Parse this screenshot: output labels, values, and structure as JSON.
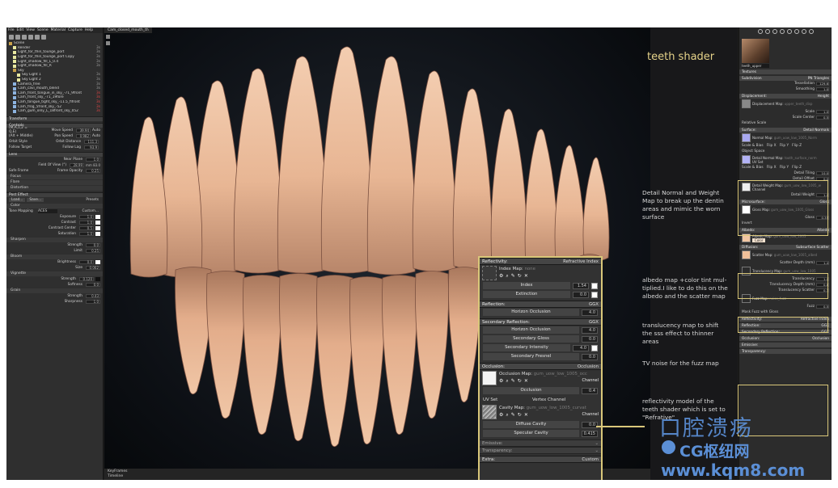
{
  "menubar": [
    "File",
    "Edit",
    "View",
    "Scene",
    "Material",
    "Capture",
    "Help"
  ],
  "viewport": {
    "tab": "Cam_closed_mouth_th",
    "footer": [
      "KeyFrames",
      "Timeline"
    ]
  },
  "scene": [
    {
      "label": "Scene",
      "icon": "scene",
      "vis": ""
    },
    {
      "label": "Render",
      "icon": "light",
      "vis": "3s"
    },
    {
      "label": "Light_for_thin_tounge_port",
      "icon": "light",
      "vis": "3s"
    },
    {
      "label": "Light_for_thin_tounge_port Copy",
      "icon": "light",
      "vis": "3s"
    },
    {
      "label": "Light_shadow_fill_L_0.4",
      "icon": "light",
      "vis": "3s"
    },
    {
      "label": "Light_shadow_fill_R",
      "icon": "light",
      "vis": "3s"
    },
    {
      "label": "Sky",
      "icon": "scene",
      "vis": ""
    },
    {
      "label": "Sky Light 1",
      "icon": "light",
      "vis": "3s"
    },
    {
      "label": "Sky Light 2",
      "icon": "light",
      "vis": "3s"
    },
    {
      "label": "Camera_free",
      "icon": "camera",
      "vis": "3s"
    },
    {
      "label": "Cam_cavi_mouth_blend",
      "icon": "camera",
      "vis": "3s"
    },
    {
      "label": "Cam_front_tongue_in_sky_-71_9front",
      "icon": "camera",
      "vis": "3s"
    },
    {
      "label": "Cam_front_sky_-71_19fore",
      "icon": "camera",
      "vis": "3s"
    },
    {
      "label": "Cam_tongue_tight_sky_-11.5_fifront",
      "icon": "camera",
      "vis": "3s"
    },
    {
      "label": "Cam_frog_5front_sky_-52",
      "icon": "camera",
      "vis": "3s"
    },
    {
      "label": "Cam_gum_only_L_18front_sky_052",
      "icon": "camera",
      "vis": "3s"
    }
  ],
  "left": {
    "transform": "Transform",
    "controls": "Controls",
    "ctrl_rows": [
      [
        "(M,A,1,2 = Q,E)",
        "Move Speed",
        "39.94",
        "Auto"
      ],
      [
        "(Alt + Middle)",
        "Pan Speed",
        "0.982",
        "Auto"
      ],
      [
        "Orbit Style",
        "Orbit Distance",
        "111.3",
        ""
      ],
      [
        "Follow Target",
        "Follow Lag",
        "93.9",
        ""
      ]
    ],
    "lens": "Lens",
    "lens_rows": [
      [
        "Near Plane",
        "1.0"
      ],
      [
        "Field Of View (°)",
        "28.99"
      ],
      [
        "Safe Frame",
        "Frame Opacity",
        "0.25"
      ]
    ],
    "lens_extra": "mm 83.0",
    "focus": "Focus",
    "flare": "Flare",
    "distortion": "Distortion",
    "post": "Post Effect",
    "post_buttons": [
      "Load...",
      "Save..."
    ],
    "presets": "Presets",
    "color": "Color",
    "tone": "Tone Mapping",
    "tone_val": "ACES",
    "custom": "Custom...",
    "color_rows": [
      [
        "Exposure",
        "1.0"
      ],
      [
        "Contrast",
        "1.0"
      ],
      [
        "Contrast Center",
        "0.5"
      ],
      [
        "Saturation",
        "1.0"
      ]
    ],
    "sharpen": "Sharpen",
    "sharpen_rows": [
      [
        "Strength",
        "0.0"
      ],
      [
        "Limit",
        "0.25"
      ]
    ],
    "bloom": "Bloom",
    "bloom_rows": [
      [
        "Brightness",
        "0.0"
      ],
      [
        "Size",
        "0.062"
      ]
    ],
    "vignette": "Vignette",
    "vign_rows": [
      [
        "Strength",
        "0.120"
      ],
      [
        "Softness",
        "0.0"
      ]
    ],
    "grain": "Grain",
    "grain_rows": [
      [
        "Strength",
        "0.43"
      ],
      [
        "Sharpness",
        "1.0"
      ]
    ]
  },
  "overlay": {
    "reflectivity": {
      "title": "Reflectivity:",
      "value": "Refractive Index",
      "map": "Index Map:",
      "map_val": "none",
      "rows": [
        [
          "Index",
          "1.54"
        ],
        [
          "Extinction",
          "0.0"
        ]
      ]
    },
    "reflection": {
      "title": "Reflection:",
      "value": "GGX",
      "rows": [
        [
          "Horizon Occlusion",
          "4.0"
        ]
      ]
    },
    "secondary": {
      "title": "Secondary Reflection:",
      "value": "GGX",
      "rows": [
        [
          "Horizon Occlusion",
          "4.0"
        ],
        [
          "Secondary Gloss",
          "0.0"
        ],
        [
          "Secondary Intensity",
          "4.0"
        ],
        [
          "Secondary Fresnel",
          "0.0"
        ]
      ]
    },
    "occlusion": {
      "title": "Occlusion:",
      "value": "Occlusion",
      "map": "Occlusion Map:",
      "map_val": "gum_uow_low_1005_occ",
      "channel": "Channel",
      "occ_label": "Occlusion",
      "occ_val": "0.4",
      "uv": "UV Set",
      "uv_val": "Vertex Channel",
      "cav_map": "Cavity Map:",
      "cav_val": "gum_uow_low_1005_curvat",
      "cav_rows": [
        [
          "Diffuse Cavity",
          "0.0"
        ],
        [
          "Specular Cavity",
          "0.415"
        ]
      ]
    },
    "emissive": "Emissive:",
    "transparency": "Transparency:",
    "extra": {
      "title": "Extra:",
      "value": "Custom"
    }
  },
  "right": {
    "mat_name": "teeth_upper",
    "sections": [
      "Textures",
      "Subdivision"
    ],
    "subdiv_val": "PN Triangles",
    "subdiv_rows": [
      [
        "Tessellation",
        "129.6"
      ],
      [
        "Smoothing",
        "1.0"
      ]
    ],
    "displacement": "Displacement:",
    "disp_val": "Height",
    "disp_map": "Displacement Map:",
    "disp_map_val": "upper_teeth_disp",
    "disp_rows": [
      [
        "Scale",
        "1.0"
      ],
      [
        "Scale Center",
        "0.5"
      ]
    ],
    "relative": "Relative Scale",
    "surface": "Surface:",
    "surface_val": "Detail Normals",
    "normal_map": "Normal Map:",
    "normal_map_val": "gum_uow_low_1005_Norm",
    "scale_bias": [
      "Scale & Bias",
      "Flip X",
      "Flip Y",
      "Flip Z"
    ],
    "object_space": "Object Space",
    "detail_normal": "Detail Normal Map:",
    "detail_normal_val": "tooth_surface_norm",
    "uv_set": "UV Set",
    "detail_rows": [
      [
        "Detail Tiling",
        "10.0"
      ],
      [
        "Detail Offset",
        "0.0"
      ]
    ],
    "detail_weight": "Detail Weight Map:",
    "detail_weight_val": "gum_uow_low_1005_w",
    "channel": "Channel",
    "detail_weight_row": [
      "Detail Weight",
      "1.0"
    ],
    "microsurface": "Microsurface:",
    "micro_val": "Gloss",
    "gloss_map": "Gloss Map:",
    "gloss_map_val": "gum_uow_low_1005_Gloss",
    "gloss_row": [
      "Gloss",
      "0.35"
    ],
    "invert": "Invert",
    "albedo": "Albedo:",
    "albedo_val": "Albedo",
    "albedo_map": "Albedo Map:",
    "albedo_map_val": "gum_uow_low_1005",
    "color": "Color",
    "diffusion": "Diffusion:",
    "diffusion_val": "Subsurface Scatter",
    "scatter_map": "Scatter Map:",
    "scatter_map_val": "gum_uow_low_1005_albed",
    "scatter_depth": [
      "Scatter Depth (mm)",
      "1.4"
    ],
    "transl_map": "Translucency Map:",
    "transl_map_val": "gum_uow_low_1005",
    "transl_rows": [
      [
        "Translucency",
        "1.0"
      ],
      [
        "Translucency Depth (mm)",
        "0.8"
      ],
      [
        "Translucency Scatter",
        "0.3"
      ]
    ],
    "fuzz_map": "Fuzz Map:",
    "fuzz_map_val": "noise_fuzz",
    "fuzz_row": [
      "Fuzz",
      "0.5"
    ],
    "mask_fuzz": "Mask Fuzz with Gloss",
    "bottom": [
      [
        "Reflectivity:",
        "Refractive Index"
      ],
      [
        "Reflection:",
        "GGX"
      ],
      [
        "Secondary Reflection:",
        "GGX"
      ],
      [
        "Occlusion:",
        "Occlusion"
      ],
      [
        "Emissive:",
        ""
      ],
      [
        "Transparency:",
        ""
      ]
    ]
  },
  "annotations": {
    "title": "teeth shader",
    "notes": [
      "Detail Normal and Weight Map to break up the dentin areas and mimic the worn surface",
      "albedo map +color tint mul-tiplied.I like to do this on the albedo and the scatter map",
      "translucency map to shift the sss effect to thinner areas",
      "TV noise for the fuzz map",
      "reflectivity model of the teeth shader which is set to \"Refrative\""
    ]
  },
  "watermark": {
    "line1": "口腔溃疡",
    "line2": "CG枢纽网",
    "line3": "www.kqm8.com"
  },
  "colors": {
    "highlight": "#d9c77a",
    "watermark": "#5b8fd6",
    "title": "#e6d38a"
  }
}
